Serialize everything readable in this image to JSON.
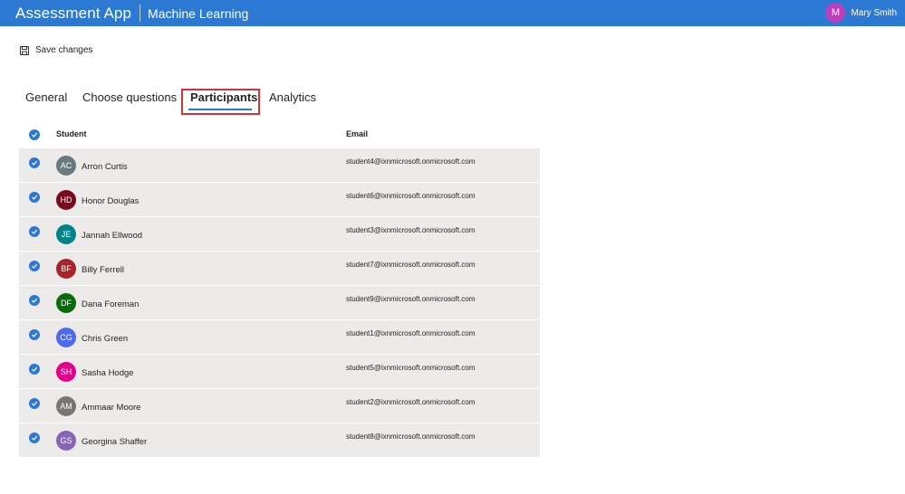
{
  "header": {
    "app_title": "Assessment App",
    "module_title": "Machine Learning",
    "user_initial": "M",
    "user_name": "Mary Smith",
    "accent_color": "#2b79d3",
    "user_avatar_color": "#bd3fbd"
  },
  "toolbar": {
    "save_label": "Save changes",
    "save_icon": "save-icon"
  },
  "tabs": [
    {
      "label": "General",
      "active": false
    },
    {
      "label": "Choose questions",
      "active": false
    },
    {
      "label": "Participants",
      "active": true
    },
    {
      "label": "Analytics",
      "active": false
    }
  ],
  "table": {
    "columns": [
      "Student",
      "Email"
    ],
    "all_selected": true,
    "rows": [
      {
        "initials": "AC",
        "name": "Arron Curtis",
        "email": "student4@ixnmicrosoft.onmicrosoft.com",
        "color": "#69797e",
        "selected": true
      },
      {
        "initials": "HD",
        "name": "Honor Douglas",
        "email": "student6@ixnmicrosoft.onmicrosoft.com",
        "color": "#750b1c",
        "selected": true
      },
      {
        "initials": "JE",
        "name": "Jannah Ellwood",
        "email": "student3@ixnmicrosoft.onmicrosoft.com",
        "color": "#038387",
        "selected": true
      },
      {
        "initials": "BF",
        "name": "Billy Ferrell",
        "email": "student7@ixnmicrosoft.onmicrosoft.com",
        "color": "#a4262c",
        "selected": true
      },
      {
        "initials": "DF",
        "name": "Dana Foreman",
        "email": "student9@ixnmicrosoft.onmicrosoft.com",
        "color": "#0b6a0b",
        "selected": true
      },
      {
        "initials": "CG",
        "name": "Chris Green",
        "email": "student1@ixnmicrosoft.onmicrosoft.com",
        "color": "#4f6bed",
        "selected": true
      },
      {
        "initials": "SH",
        "name": "Sasha Hodge",
        "email": "student5@ixnmicrosoft.onmicrosoft.com",
        "color": "#e3008c",
        "selected": true
      },
      {
        "initials": "AM",
        "name": "Ammaar Moore",
        "email": "student2@ixnmicrosoft.onmicrosoft.com",
        "color": "#7a7574",
        "selected": true
      },
      {
        "initials": "GS",
        "name": "Georgina Shaffer",
        "email": "student8@ixnmicrosoft.onmicrosoft.com",
        "color": "#8764b8",
        "selected": true
      }
    ]
  }
}
